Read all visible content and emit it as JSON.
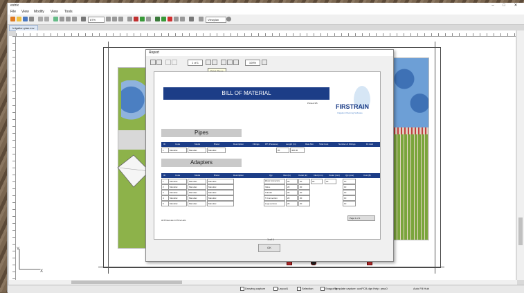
{
  "window": {
    "title": "estrix",
    "controls": [
      "–",
      "□",
      "✕"
    ]
  },
  "menu": [
    "File",
    "View",
    "Modify",
    "View",
    "Tools"
  ],
  "toolbar": {
    "zoom_value": "87%",
    "view_label": "Viewplan"
  },
  "tab": {
    "label": "Irrigation plan.ecv"
  },
  "dialog": {
    "title": "Report",
    "page_input": "1 of 1",
    "zoom_input": "100%",
    "tooltip": "Print Page",
    "ok_label": "OK",
    "page_indicator": "1 of 1"
  },
  "report": {
    "title": "BILL OF MATERIAL",
    "subtitle": "Printed 3/5",
    "logo_text": "FIRSTRAIN",
    "logo_tag": "Irrigation Planning Software",
    "pipes": {
      "heading": "Pipes",
      "columns": [
        "ID",
        "Code",
        "Model",
        "Brand",
        "Description",
        "Fittings",
        "PP (Pressure)",
        "Length (m)",
        "Rate $/m",
        "Total Cost",
        "Number of Fittings",
        "Fit total"
      ],
      "rows": [
        [
          "1",
          "Manufac",
          "Manufac",
          "Manufac",
          "",
          "",
          "",
          "20",
          "400.00",
          "",
          "",
          ""
        ]
      ]
    },
    "adapters": {
      "heading": "Adapters",
      "columns": [
        "ID",
        "Code",
        "Model",
        "Brand",
        "Description",
        "Qty",
        "Inlet (in)",
        "Outlet (in)",
        "Inlet (mm)",
        "Outlet (mm)",
        "Qty (pcs)",
        "Cost ($)"
      ],
      "rows": [
        [
          "1",
          "Manufac",
          "Manufac",
          "Manufac",
          "",
          "Elbow Connectors",
          "20",
          "20",
          "20",
          "20",
          "10",
          ""
        ],
        [
          "2",
          "Manufac",
          "Manufac",
          "Manufac",
          "",
          "Valve",
          "20",
          "20",
          "",
          "",
          "10",
          ""
        ],
        [
          "3",
          "Manufac",
          "Manufac",
          "Manufac",
          "",
          "Tubular",
          "20",
          "20",
          "",
          "",
          "10",
          ""
        ],
        [
          "4",
          "Manufac",
          "Manufac",
          "Manufac",
          "",
          "T-Connection",
          "20",
          "20",
          "",
          "",
          "10",
          ""
        ],
        [
          "5",
          "Manufac",
          "Manufac",
          "Manufac",
          "",
          "Lugs (union)",
          "20",
          "20",
          "",
          "",
          "10",
          ""
        ]
      ]
    },
    "footnote": "All Prices are in Price Lists",
    "page_button": "Page 1 of 1"
  },
  "statusbar": [
    "Drawing capture",
    "Layout1",
    "Selection",
    "Snapping",
    "Template capture: ucsPCB.dgn  Help: prac0",
    "Auto Fill Hub"
  ],
  "colors": {
    "accent": "#1c3d87",
    "plan_green": "#8db24a",
    "plan_blue": "#4b7fc2"
  }
}
